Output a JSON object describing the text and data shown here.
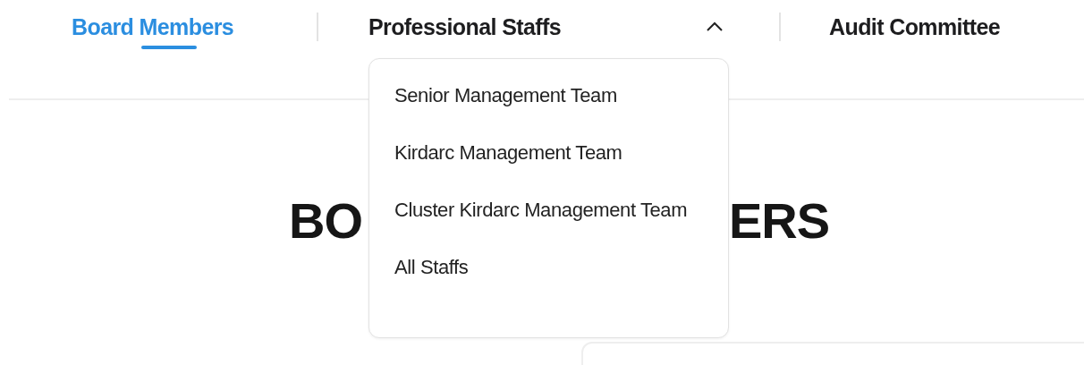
{
  "tabs": [
    {
      "label": "Board Members",
      "selected": true,
      "kind": "link"
    },
    {
      "label": "Professional Staffs",
      "selected": false,
      "kind": "dropdown",
      "expanded": true
    },
    {
      "label": "Audit Committee",
      "selected": false,
      "kind": "link"
    }
  ],
  "dropdown_menu": {
    "items": [
      "Senior Management Team",
      "Kirdarc Management Team",
      "Cluster Kirdarc Management Team",
      "All Staffs"
    ]
  },
  "heading": {
    "visible_parts": [
      "BO",
      "ERS"
    ]
  }
}
